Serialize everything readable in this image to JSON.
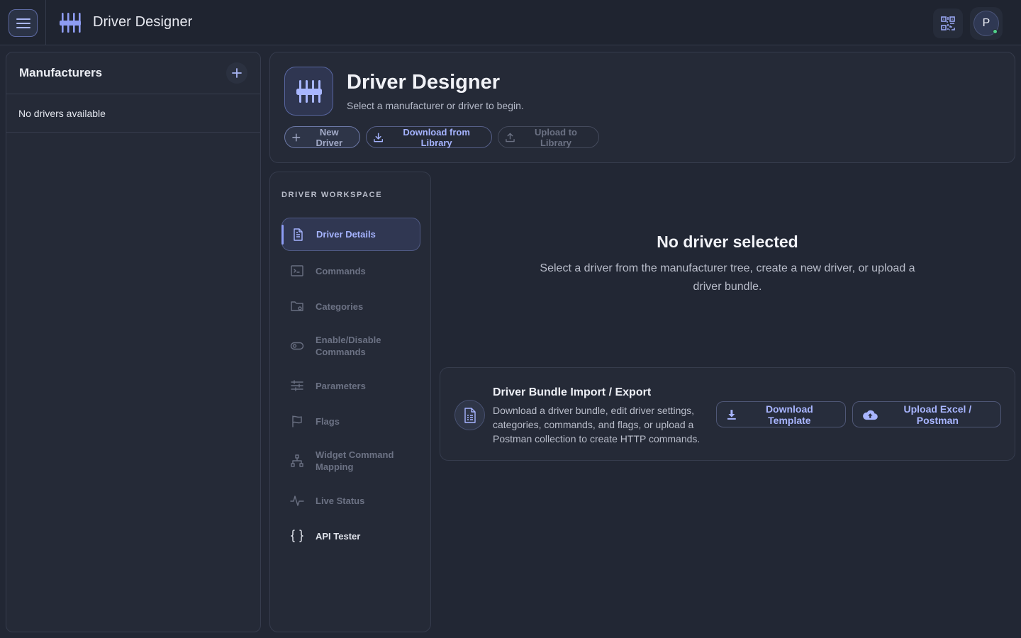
{
  "app": {
    "title": "Driver Designer"
  },
  "topbar": {
    "avatar_initial": "P"
  },
  "manufacturers": {
    "title": "Manufacturers",
    "empty_text": "No drivers available"
  },
  "hero": {
    "title": "Driver Designer",
    "subtitle": "Select a manufacturer or driver to begin.",
    "new_driver_label": "New Driver",
    "download_library_label": "Download from Library",
    "upload_library_label": "Upload to Library"
  },
  "workspace": {
    "label": "DRIVER WORKSPACE",
    "items": [
      {
        "label": "Driver Details",
        "icon": "document-icon",
        "state": "active"
      },
      {
        "label": "Commands",
        "icon": "terminal-icon",
        "state": "disabled"
      },
      {
        "label": "Categories",
        "icon": "folder-settings-icon",
        "state": "disabled"
      },
      {
        "label": "Enable/Disable Commands",
        "icon": "toggle-icon",
        "state": "disabled"
      },
      {
        "label": "Parameters",
        "icon": "sliders-icon",
        "state": "disabled"
      },
      {
        "label": "Flags",
        "icon": "flag-icon",
        "state": "disabled"
      },
      {
        "label": "Widget Command Mapping",
        "icon": "hierarchy-icon",
        "state": "disabled"
      },
      {
        "label": "Live Status",
        "icon": "activity-icon",
        "state": "disabled"
      },
      {
        "label": "API Tester",
        "icon": "braces-icon",
        "state": "enabled"
      }
    ]
  },
  "empty_state": {
    "title": "No driver selected",
    "description": "Select a driver from the manufacturer tree, create a new driver, or upload a driver bundle."
  },
  "bundle": {
    "title": "Driver Bundle Import / Export",
    "description": "Download a driver bundle, edit driver settings, categories, commands, and flags, or upload a Postman collection to create HTTP commands.",
    "download_template_label": "Download Template",
    "upload_excel_label": "Upload Excel / Postman"
  },
  "colors": {
    "background": "#222734",
    "panel": "#252a37",
    "accent": "#a6b4ff",
    "status_online": "#52d18a"
  }
}
